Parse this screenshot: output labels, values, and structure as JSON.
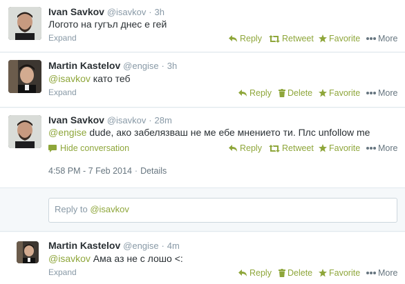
{
  "tweets": [
    {
      "fullname": "Ivan Savkov",
      "username": "@isavkov",
      "time": "3h",
      "mention": "",
      "text": "Логото на гугъл днес е гей",
      "expand": "Expand",
      "actions": [
        "Reply",
        "Retweet",
        "Favorite",
        "More"
      ]
    },
    {
      "fullname": "Martin Kastelov",
      "username": "@engise",
      "time": "3h",
      "mention": "@isavkov",
      "text": " като теб",
      "expand": "Expand",
      "actions": [
        "Reply",
        "Delete",
        "Favorite",
        "More"
      ]
    },
    {
      "fullname": "Ivan Savkov",
      "username": "@isavkov",
      "time": "28m",
      "mention": "@engise",
      "text": " dude, ако забелязваш не ме ебе мнението ти. Плс unfollow me",
      "hide_conversation": "Hide conversation",
      "timestamp": "4:58 PM - 7 Feb 2014",
      "details": "Details",
      "actions": [
        "Reply",
        "Retweet",
        "Favorite",
        "More"
      ]
    },
    {
      "fullname": "Martin Kastelov",
      "username": "@engise",
      "time": "4m",
      "mention": "@isavkov",
      "text": " Ама аз не с лошо <:",
      "expand": "Expand",
      "actions": [
        "Reply",
        "Delete",
        "Favorite",
        "More"
      ]
    }
  ],
  "reply_box": {
    "prefix": "Reply to ",
    "mention": "@isavkov"
  },
  "separators": {
    "dot": "·",
    "dash": "-"
  },
  "colors": {
    "link_green": "#8ea63a",
    "muted": "#8899a6",
    "text": "#292f33"
  },
  "icons": [
    "reply-icon",
    "retweet-icon",
    "favorite-icon",
    "more-icon",
    "delete-icon",
    "conversation-icon"
  ]
}
